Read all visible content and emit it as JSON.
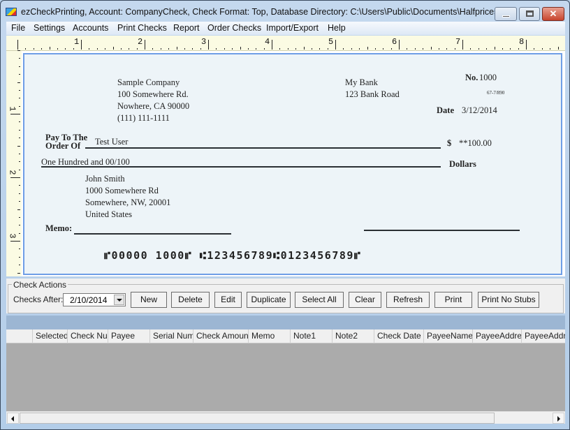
{
  "window": {
    "title": "ezCheckPrinting, Account: CompanyCheck, Check Format: Top, Database Directory: C:\\Users\\Public\\Documents\\Halfpricesoft...",
    "controls": {
      "minimize": "minimize",
      "maximize": "maximize",
      "close": "✕"
    }
  },
  "menu": [
    "File",
    "Settings",
    "Accounts",
    "Print Checks",
    "Report",
    "Order Checks",
    "Import/Export",
    "Help"
  ],
  "ruler": {
    "horizontal": [
      "1",
      "2",
      "3",
      "4",
      "5",
      "6",
      "7",
      "8"
    ],
    "vertical": [
      "1",
      "2",
      "3"
    ]
  },
  "check": {
    "company": {
      "name": "Sample Company",
      "address1": "100 Somewhere Rd.",
      "address2": "Nowhere, CA 90000",
      "phone": "(111) 111-1111"
    },
    "bank": {
      "name": "My Bank",
      "address": "123 Bank Road",
      "fraction": "67-7/890"
    },
    "number_label": "No.",
    "number": "1000",
    "date_label": "Date",
    "date": "3/12/2014",
    "pay_to_label_1": "Pay To The",
    "pay_to_label_2": "Order Of",
    "payee": "Test User",
    "currency_symbol": "$",
    "amount": "**100.00",
    "amount_words": "One Hundred  and 00/100",
    "dollars_label": "Dollars",
    "recipient": {
      "name": "John Smith",
      "address1": "1000 Somewhere Rd",
      "address2": "Somewhere, NW, 20001",
      "country": "United States"
    },
    "memo_label": "Memo:",
    "micr": "⑈00000 1000⑈ ⑆123456789⑆0123456789⑈"
  },
  "actions": {
    "group_label": "Check Actions",
    "checks_after_label": "Checks After:",
    "checks_after_value": "2/10/2014",
    "buttons": [
      "New",
      "Delete",
      "Edit",
      "Duplicate",
      "Select All",
      "Clear",
      "Refresh",
      "Print",
      "Print No Stubs"
    ]
  },
  "grid": {
    "columns": [
      "Selected",
      "Check Nu",
      "Payee",
      "Serial Num",
      "Check Amount",
      "Memo",
      "Note1",
      "Note2",
      "Check Date",
      "PayeeName",
      "PayeeAddre",
      "PayeeAddre"
    ],
    "rows": []
  }
}
